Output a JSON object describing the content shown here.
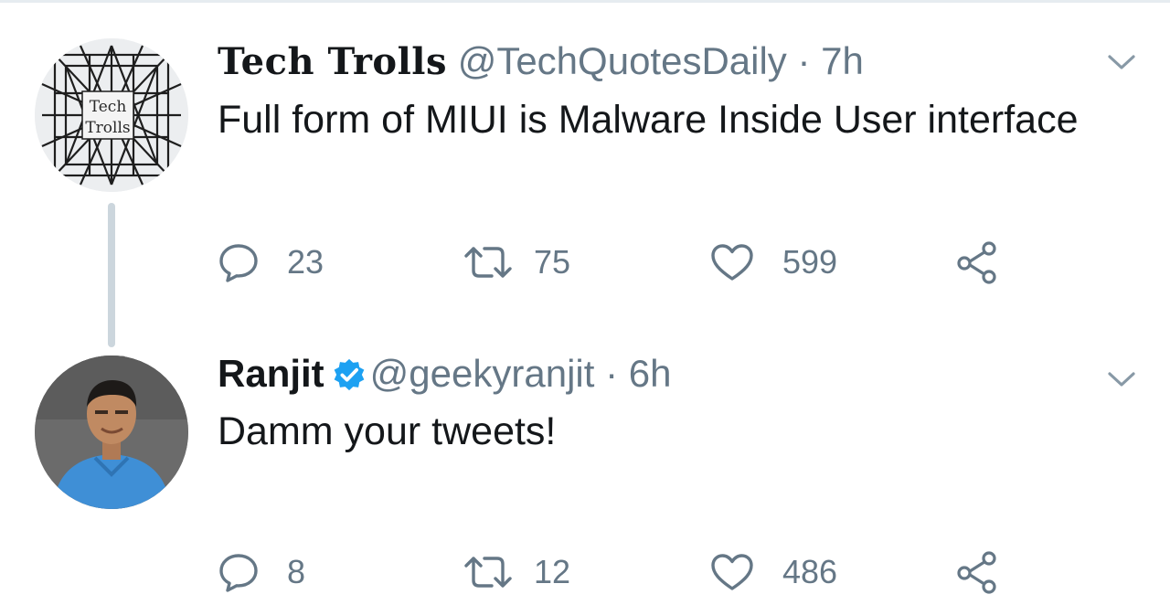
{
  "colors": {
    "text": "#14171a",
    "secondary": "#657786",
    "thread_line": "#ccd6dd",
    "verified": "#1da1f2"
  },
  "tweets": [
    {
      "display_name": "Tech Trolls",
      "handle": "@TechQuotesDaily",
      "separator": "·",
      "time": "7h",
      "text": "Full form of MIUI is Malware Inside User interface",
      "verified": false,
      "avatar_text": {
        "line1": "Tech",
        "line2": "Trolls"
      },
      "counts": {
        "replies": "23",
        "retweets": "75",
        "likes": "599"
      }
    },
    {
      "display_name": "Ranjit",
      "handle": "@geekyranjit",
      "separator": "·",
      "time": "6h",
      "text": "Damm your tweets!",
      "verified": true,
      "counts": {
        "replies": "8",
        "retweets": "12",
        "likes": "486"
      }
    }
  ],
  "icons": {
    "reply": "speech-bubble-icon",
    "retweet": "retweet-arrows-icon",
    "like": "heart-outline-icon",
    "share": "share-nodes-icon",
    "menu": "chevron-down-icon",
    "verified": "verified-badge-icon"
  }
}
